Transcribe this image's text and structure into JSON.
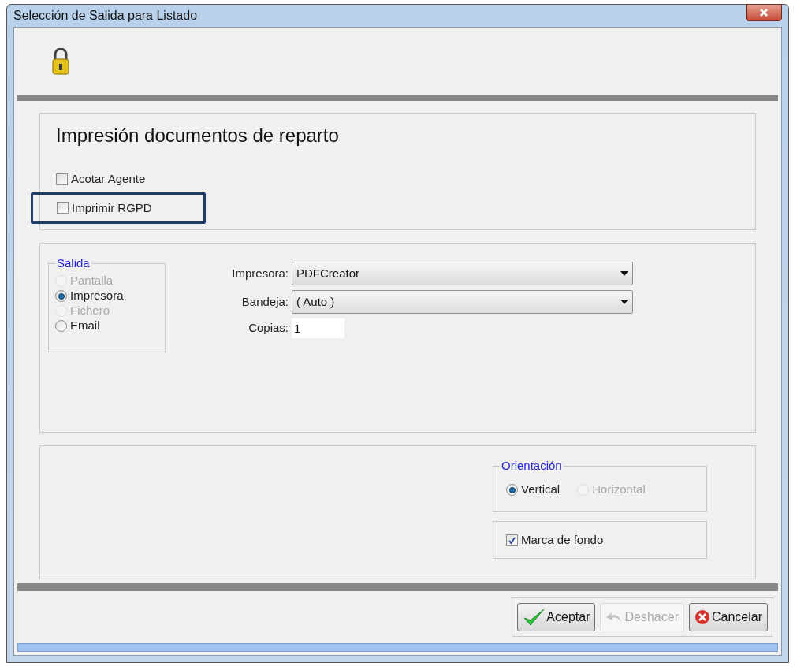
{
  "window": {
    "title": "Selección de Salida para Listado"
  },
  "section": {
    "heading": "Impresión documentos de reparto",
    "options": [
      {
        "label": "Acotar Agente",
        "checked": false,
        "highlighted": false
      },
      {
        "label": "Imprimir RGPD",
        "checked": false,
        "highlighted": true
      }
    ]
  },
  "output": {
    "legend": "Salida",
    "radios": [
      {
        "label": "Pantalla",
        "selected": false,
        "disabled": true
      },
      {
        "label": "Impresora",
        "selected": true,
        "disabled": false
      },
      {
        "label": "Fichero",
        "selected": false,
        "disabled": true
      },
      {
        "label": "Email",
        "selected": false,
        "disabled": false
      }
    ],
    "fields": [
      {
        "kind": "select",
        "label": "Impresora:",
        "value": "PDFCreator"
      },
      {
        "kind": "select",
        "label": "Bandeja:",
        "value": "( Auto )"
      },
      {
        "kind": "text",
        "label": "Copias:",
        "value": "1"
      }
    ]
  },
  "orientation": {
    "legend": "Orientación",
    "radios": [
      {
        "label": "Vertical",
        "selected": true,
        "disabled": false
      },
      {
        "label": "Horizontal",
        "selected": false,
        "disabled": true
      }
    ]
  },
  "watermark": {
    "label": "Marca de fondo",
    "checked": true
  },
  "buttons": [
    {
      "kind": "accept",
      "label": "Aceptar",
      "disabled": false
    },
    {
      "kind": "undo",
      "label": "Deshacer",
      "disabled": true
    },
    {
      "kind": "cancel",
      "label": "Cancelar",
      "disabled": false
    }
  ]
}
